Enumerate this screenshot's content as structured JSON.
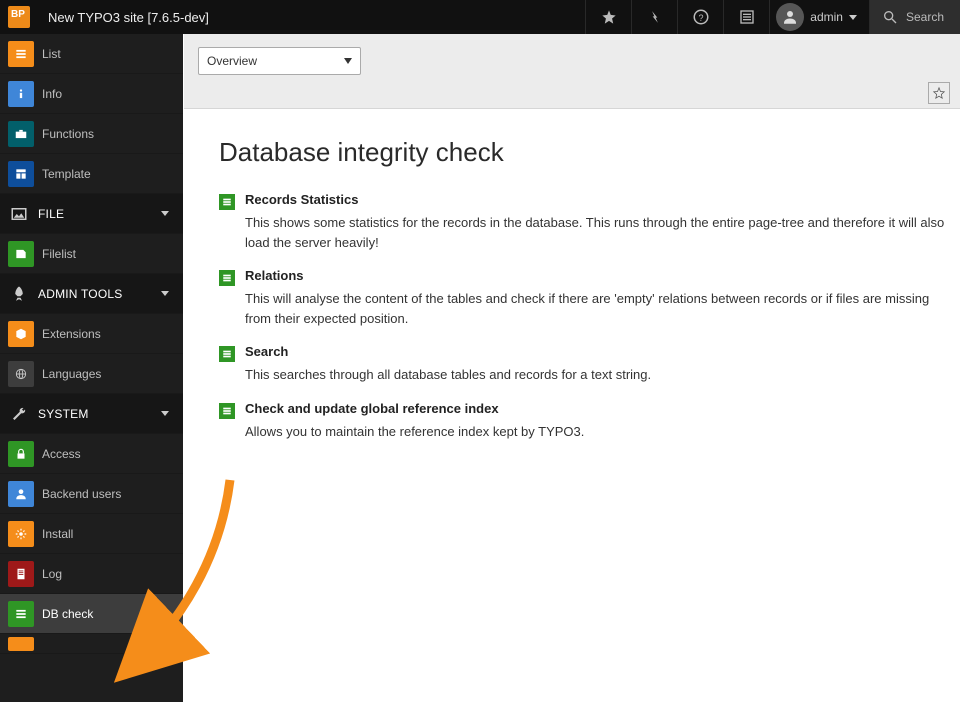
{
  "topbar": {
    "site_title": "New TYPO3 site [7.6.5-dev]",
    "user_name": "admin",
    "search_label": "Search"
  },
  "sidebar": {
    "top_items": [
      {
        "label": "List"
      },
      {
        "label": "Info"
      },
      {
        "label": "Functions"
      },
      {
        "label": "Template"
      }
    ],
    "sections": [
      {
        "title": "FILE",
        "items": [
          {
            "label": "Filelist"
          }
        ]
      },
      {
        "title": "ADMIN TOOLS",
        "items": [
          {
            "label": "Extensions"
          },
          {
            "label": "Languages"
          }
        ]
      },
      {
        "title": "SYSTEM",
        "items": [
          {
            "label": "Access"
          },
          {
            "label": "Backend users"
          },
          {
            "label": "Install"
          },
          {
            "label": "Log"
          },
          {
            "label": "DB check"
          }
        ]
      }
    ]
  },
  "docheader": {
    "select_value": "Overview"
  },
  "page": {
    "heading": "Database integrity check",
    "items": [
      {
        "title": "Records Statistics",
        "desc": "This shows some statistics for the records in the database. This runs through the entire page-tree and therefore it will also load the server heavily!"
      },
      {
        "title": "Relations",
        "desc": "This will analyse the content of the tables and check if there are 'empty' relations between records or if files are missing from their expected position."
      },
      {
        "title": "Search",
        "desc": "This searches through all database tables and records for a text string."
      },
      {
        "title": "Check and update global reference index",
        "desc": "Allows you to maintain the reference index kept by TYPO3."
      }
    ]
  }
}
